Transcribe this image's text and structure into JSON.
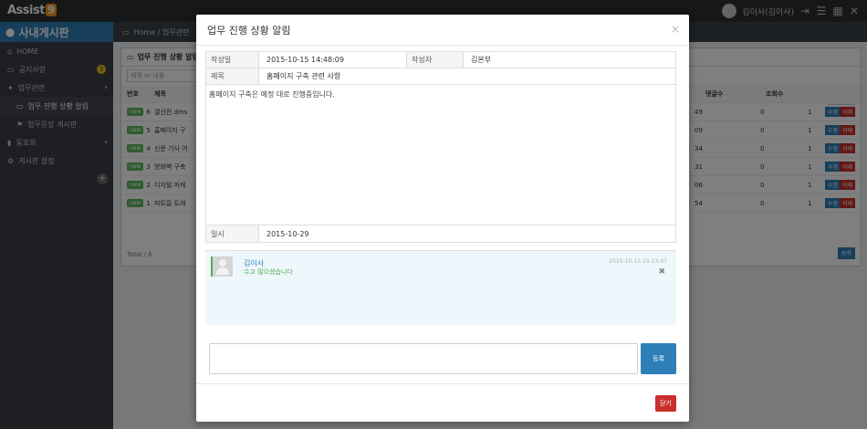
{
  "app": {
    "logo_text": "Assist",
    "logo_num": "9",
    "user_name": "김이사(김이사)"
  },
  "sidebar": {
    "title": "사내게시판",
    "items": [
      {
        "label": "HOME"
      },
      {
        "label": "공지사항",
        "badge": "3"
      },
      {
        "label": "업무관련"
      },
      {
        "label": "업무 진행 상황 알림"
      },
      {
        "label": "업무문장 게시판"
      },
      {
        "label": "동호회"
      },
      {
        "label": "게시판 설정"
      }
    ]
  },
  "breadcrumb": "Home / 업무관련",
  "list": {
    "panel_title": "업무 진행 상황 알림",
    "search_placeholder": "제목 or 내용",
    "page_size": "20",
    "headers": [
      "번호",
      "제목",
      "댓글수",
      "조회수"
    ],
    "rows": [
      {
        "num": "6",
        "title": "결산전 dms",
        "tail": "49",
        "comments": "0",
        "views": "1"
      },
      {
        "num": "5",
        "title": "홈페이지 구",
        "tail": "09",
        "comments": "0",
        "views": "1"
      },
      {
        "num": "4",
        "title": "신문 기사 어",
        "tail": "34",
        "comments": "0",
        "views": "1"
      },
      {
        "num": "3",
        "title": "방화벽 구축",
        "tail": "31",
        "comments": "0",
        "views": "1"
      },
      {
        "num": "2",
        "title": "디지털 마케",
        "tail": "06",
        "comments": "0",
        "views": "1"
      },
      {
        "num": "1",
        "title": "피트릴 트레",
        "tail": "54",
        "comments": "0",
        "views": "1"
      }
    ],
    "new_tag": "new",
    "edit_label": "수정",
    "delete_label": "삭제",
    "total": "Total / 6",
    "register_label": "등록"
  },
  "modal": {
    "title": "업무 진행 상황 알림",
    "close_icon": "×",
    "fields": {
      "date_label": "작성일",
      "date_value": "2015-10-15 14:48:09",
      "author_label": "작성자",
      "author_value": "김본부",
      "subject_label": "제목",
      "subject_value": "홈페이지 구축 관련 사항",
      "body": "홈페이지 구축은 예정 대로 진행중입니다.",
      "when_label": "일시",
      "when_value": "2015-10-29"
    },
    "comment": {
      "author": "김이사",
      "text": "수고 많으셨습니다",
      "time": "2015-10-15 15:13:47",
      "delete_icon": "✖"
    },
    "reply": {
      "placeholder": "",
      "submit_label": "등록"
    },
    "close_label": "닫기"
  },
  "colors": {
    "primary": "#2e7fb8",
    "danger": "#c9302c",
    "success": "#5cb85c"
  }
}
